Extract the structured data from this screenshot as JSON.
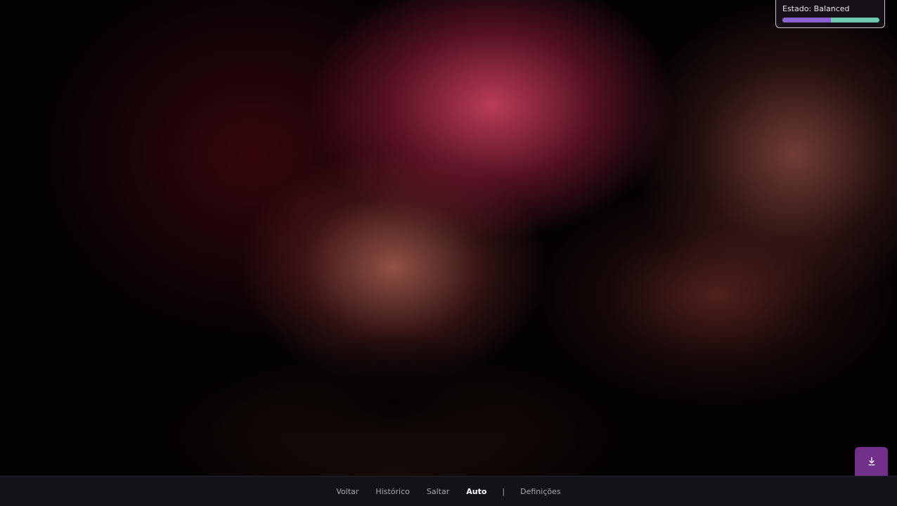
{
  "status": {
    "label": "Estado:",
    "value": "Balanced",
    "bar": {
      "fill_fraction": 0.5,
      "fill_color": "#8c5fd0",
      "track_color": "#6fc9b2"
    }
  },
  "save_button": {
    "icon": "download-icon",
    "color": "#73308a"
  },
  "menu": {
    "items": [
      {
        "label": "Voltar",
        "active": false
      },
      {
        "label": "Histórico",
        "active": false
      },
      {
        "label": "Saltar",
        "active": false
      },
      {
        "label": "Auto",
        "active": true
      }
    ],
    "separator": "|",
    "settings": {
      "label": "Definições"
    }
  },
  "colors": {
    "bottom_bar": "#131219",
    "menu_text": "#a8a6ae",
    "menu_active": "#ffffff"
  }
}
